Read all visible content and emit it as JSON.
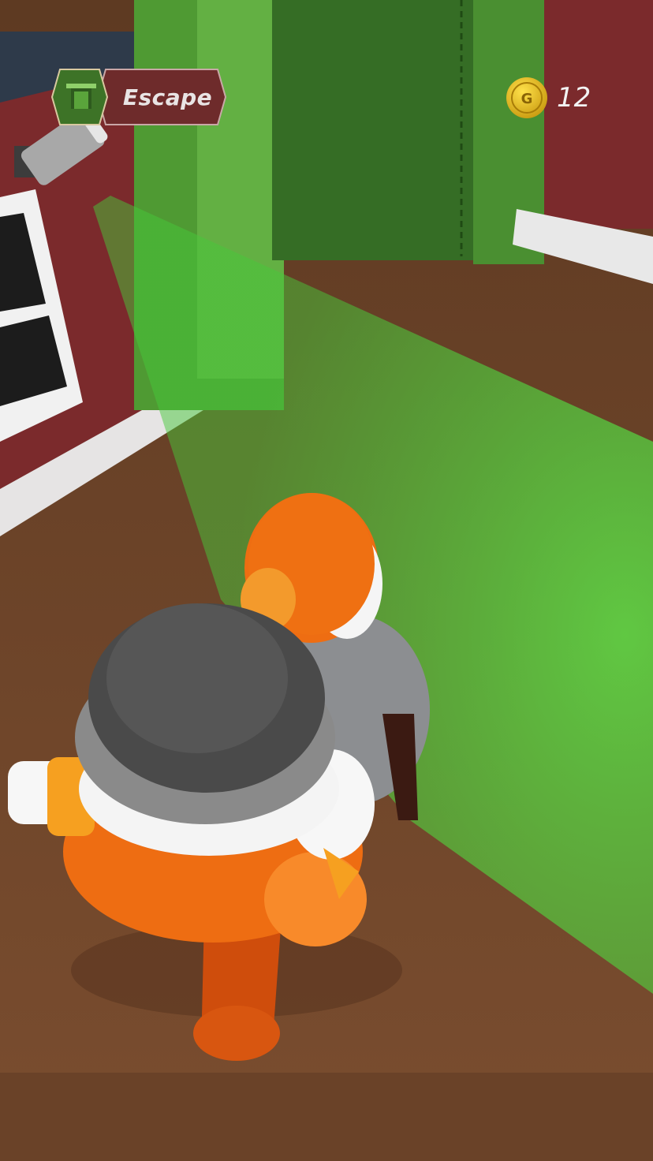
{
  "hud": {
    "objective": {
      "label": "Escape",
      "icon": "door-icon"
    },
    "coins": {
      "count": "12",
      "icon": "coin-icon",
      "coin_letter": "G"
    }
  },
  "colors": {
    "floor": "#7a4b2e",
    "wall": "#7e2c2c",
    "door": "#3f8a2c",
    "vision_cone": "#46e03a",
    "prisoner_uniform": "#ee6d12",
    "guard_uniform": "#8d8f92"
  }
}
